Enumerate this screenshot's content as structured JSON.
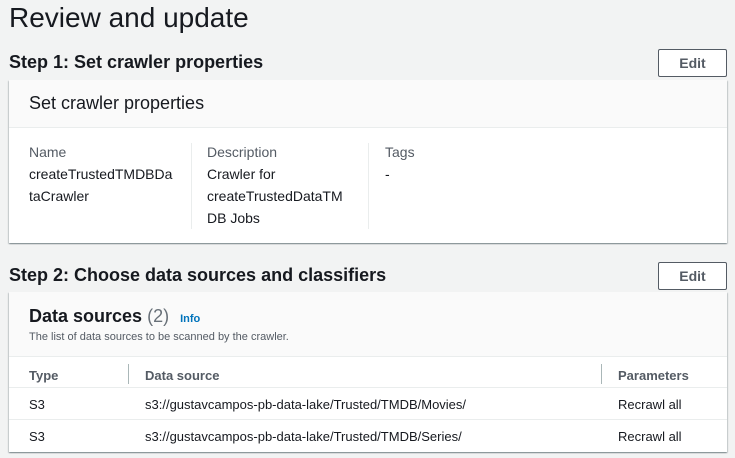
{
  "page": {
    "title": "Review and update"
  },
  "step1": {
    "title": "Step 1: Set crawler properties",
    "edit_label": "Edit",
    "panel_title": "Set crawler properties",
    "name_label": "Name",
    "name_value_line1": "createTrustedTMDBDa",
    "name_value_line2": "taCrawler",
    "description_label": "Description",
    "description_line1": "Crawler for",
    "description_line2": "createTrustedDataTM",
    "description_line3": "DB Jobs",
    "tags_label": "Tags",
    "tags_value": "-"
  },
  "step2": {
    "title": "Step 2: Choose data sources and classifiers",
    "edit_label": "Edit",
    "data_sources": {
      "title": "Data sources",
      "count": "(2)",
      "info_label": "Info",
      "description": "The list of data sources to be scanned by the crawler.",
      "columns": [
        "Type",
        "Data source",
        "Parameters"
      ],
      "rows": [
        {
          "type": "S3",
          "source": "s3://gustavcampos-pb-data-lake/Trusted/TMDB/Movies/",
          "parameters": "Recrawl all"
        },
        {
          "type": "S3",
          "source": "s3://gustavcampos-pb-data-lake/Trusted/TMDB/Series/",
          "parameters": "Recrawl all"
        }
      ]
    }
  }
}
